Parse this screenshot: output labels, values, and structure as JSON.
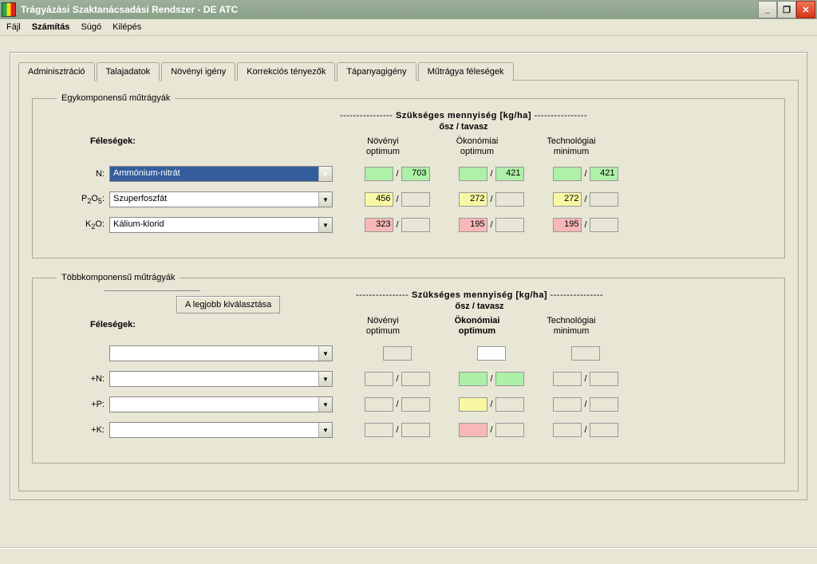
{
  "window": {
    "title": "Trágyázási Szaktanácsadási Rendszer - DE ATC"
  },
  "menu": {
    "file": "Fájl",
    "calc": "Számítás",
    "help": "Súgó",
    "exit": "Kilépés"
  },
  "tabs": {
    "admin": "Adminisztráció",
    "soil": "Talajadatok",
    "plant": "Növényi igény",
    "corr": "Korrekciós tényezők",
    "nutrient": "Tápanyagigény",
    "fert": "Műtrágya féleségek"
  },
  "group1": {
    "legend": "Egykomponensű  műtrágyák",
    "header_main_pre": "---------------- ",
    "header_main_txt": "Szükséges mennyiség [kg/ha]",
    "header_main_post": " ----------------",
    "header_sub": "ősz / tavasz",
    "col1": "Növényi\noptimum",
    "col2": "Ökonómiai\noptimum",
    "col3": "Technológiai\nminimum",
    "felesegek": "Féleségek:",
    "rows": {
      "n": {
        "label": "N:",
        "combo": "Ammónium-nitrát",
        "v1a": "",
        "v1b": "703",
        "v2a": "",
        "v2b": "421",
        "v3a": "",
        "v3b": "421"
      },
      "p": {
        "label_html": "P₂O₅:",
        "combo": "Szuperfoszfát",
        "v1a": "456",
        "v1b": "",
        "v2a": "272",
        "v2b": "",
        "v3a": "272",
        "v3b": ""
      },
      "k": {
        "label_html": "K₂O:",
        "combo": "Kálium-klorid",
        "v1a": "323",
        "v1b": "",
        "v2a": "195",
        "v2b": "",
        "v3a": "195",
        "v3b": ""
      }
    }
  },
  "group2": {
    "legend": "Többkomponensű  műtrágyák",
    "best_btn": "A legjobb kiválasztása",
    "header_main_pre": "---------------- ",
    "header_main_txt": "Szükséges mennyiség [kg/ha]",
    "header_main_post": " ----------------",
    "header_sub": "ősz / tavasz",
    "col1": "Növényi\noptimum",
    "col2": "Ökonómiai\noptimum",
    "col3": "Technológiai\nminimum",
    "felesegek": "Féleségek:",
    "rows": {
      "r0": {
        "label": "",
        "combo": ""
      },
      "rn": {
        "label": "+N:",
        "combo": ""
      },
      "rp": {
        "label": "+P:",
        "combo": ""
      },
      "rk": {
        "label": "+K:",
        "combo": ""
      }
    }
  }
}
